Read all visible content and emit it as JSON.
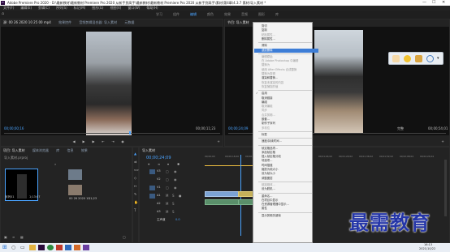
{
  "window": {
    "title": "Adobe Premiere Pro 2020 - D:\\最新教材\\最新教材 Premiere Pro 2020 从新手到高手\\最新教材\\最新教材 Premiere Pro 2020 从新手到高手\\素材\\第4章\\4.3.7 素材\\导入素材 *",
    "minimize": "—",
    "maximize": "☐",
    "close": "✕"
  },
  "menu": [
    "文件(F)",
    "编辑(E)",
    "剪辑(C)",
    "序列(S)",
    "标记(M)",
    "图形(G)",
    "视图(V)",
    "窗口(W)",
    "帮助(H)"
  ],
  "workspaces": [
    "学习",
    "组件",
    "编辑",
    "颜色",
    "效果",
    "音频",
    "图形",
    "库"
  ],
  "source_panel": {
    "tabs": [
      "源: 00 26 2020 10 25 00 mp4",
      "效果控件",
      "音频剪辑混合器: 导入素材",
      "元数据"
    ],
    "timecode_left": "00;00;00;16",
    "timecode_right": "00;00;11;23"
  },
  "program_panel": {
    "tab": "节目: 导入素材",
    "timecode_left": "00;00;24;09",
    "fit": "完整",
    "timecode_right": "00;00;54;01"
  },
  "project_panel": {
    "tabs": [
      "项目: 导入素材",
      "媒体浏览器",
      "库",
      "信息",
      "效果"
    ],
    "file": "导入素材.prproj",
    "items": [
      {
        "name": "序列01",
        "dur": "1;13;07"
      },
      {
        "name": "00 26 2020 10",
        "dur": "11;23"
      }
    ]
  },
  "timeline": {
    "tab": "导入素材",
    "timecode": "00;00;24;09",
    "ruler": [
      "00;00;00",
      "00;00;16;00",
      "00;00;32;00",
      "00;00;48;00",
      "00;01;04;02",
      "00;01;20;02",
      "00;01;36;02",
      "00;01;52;02",
      "00;02;08;04",
      "00;02;24;04"
    ],
    "tracks": [
      "V3",
      "V2",
      "V1",
      "A1",
      "A2",
      "A3",
      "主声道"
    ],
    "master_value": "0.0"
  },
  "context_menu": {
    "items": [
      {
        "label": "剪切",
        "state": "normal"
      },
      {
        "label": "复制",
        "state": "normal"
      },
      {
        "label": "粘贴属性...",
        "state": "disabled"
      },
      {
        "label": "删除属性...",
        "state": "normal"
      },
      {
        "sep": true
      },
      {
        "label": "清除",
        "state": "normal"
      },
      {
        "label": "波纹删除",
        "state": "highlight"
      },
      {
        "sep": true
      },
      {
        "label": "编辑原始",
        "state": "disabled"
      },
      {
        "label": "在 Adobe Photoshop 中编辑",
        "state": "disabled"
      },
      {
        "label": "替换为",
        "state": "disabled"
      },
      {
        "label": "使用 After Effects 合成替换",
        "state": "disabled"
      },
      {
        "label": "替换为剪辑",
        "state": "disabled"
      },
      {
        "label": "渲染和替换...",
        "state": "normal"
      },
      {
        "label": "恢复未渲染的内容",
        "state": "disabled"
      },
      {
        "label": "恢复捕捉的值",
        "state": "disabled"
      },
      {
        "sep": true
      },
      {
        "label": "启用",
        "state": "normal",
        "check": "✓"
      },
      {
        "label": "取消链接",
        "state": "normal"
      },
      {
        "label": "编组",
        "state": "normal"
      },
      {
        "label": "取消编组",
        "state": "disabled"
      },
      {
        "label": "同步",
        "state": "disabled"
      },
      {
        "label": "合并剪辑...",
        "state": "disabled"
      },
      {
        "label": "嵌套...",
        "state": "normal"
      },
      {
        "label": "制作子序列",
        "state": "normal"
      },
      {
        "label": "多机位",
        "state": "disabled"
      },
      {
        "sep": true
      },
      {
        "label": "标签",
        "state": "normal"
      },
      {
        "sep": true
      },
      {
        "label": "速度/持续时间...",
        "state": "normal"
      },
      {
        "sep": true
      },
      {
        "label": "帧定格选项...",
        "state": "normal"
      },
      {
        "label": "添加帧定格",
        "state": "normal"
      },
      {
        "label": "插入帧定格分段",
        "state": "normal"
      },
      {
        "label": "场选项...",
        "state": "normal"
      },
      {
        "label": "时间插值",
        "state": "normal"
      },
      {
        "label": "缩放为帧大小",
        "state": "normal"
      },
      {
        "label": "设为帧大小",
        "state": "normal"
      },
      {
        "label": "调整图层",
        "state": "normal"
      },
      {
        "sep": true
      },
      {
        "label": "链接媒体...",
        "state": "disabled"
      },
      {
        "label": "设为脱机...",
        "state": "normal"
      },
      {
        "sep": true
      },
      {
        "label": "重命名...",
        "state": "normal"
      },
      {
        "label": "在项目中显示",
        "state": "normal"
      },
      {
        "label": "在资源管理器中显示...",
        "state": "normal"
      },
      {
        "label": "属性",
        "state": "normal"
      },
      {
        "sep": true
      },
      {
        "label": "显示剪辑关键帧",
        "state": "normal"
      }
    ]
  },
  "watermark": "最需教育",
  "taskbar": {
    "time": "16:13",
    "date": "2021/10/22"
  },
  "colors": {
    "accent": "#4aa3ff",
    "highlight": "#3d7dd6",
    "clip_blue": "#7ca3d4",
    "watermark": "#2536a8"
  }
}
